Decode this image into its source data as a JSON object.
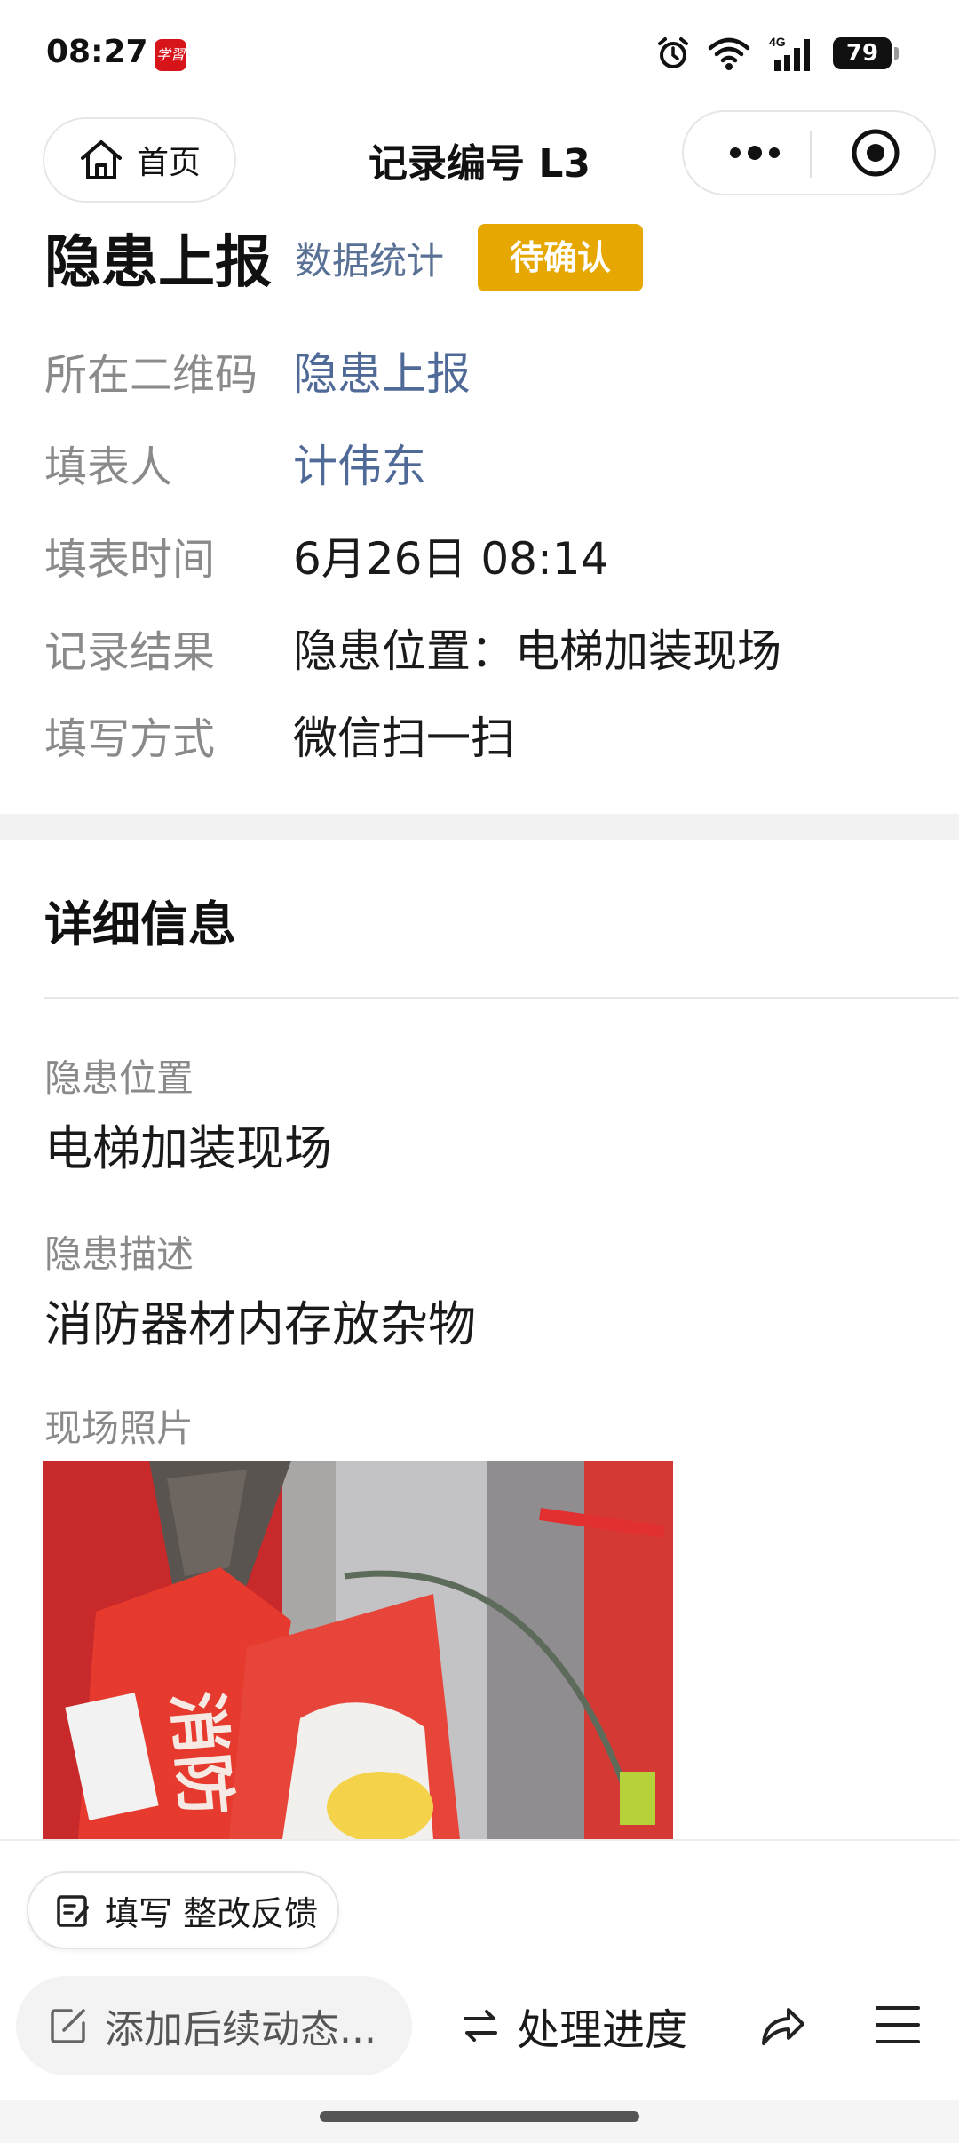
{
  "status_bar": {
    "time": "08:27",
    "app_badge": "学習",
    "network": "4G",
    "battery": "79"
  },
  "nav": {
    "home_label": "首页",
    "title": "记录编号 L3"
  },
  "record": {
    "title": "隐患上报",
    "stats_link": "数据统计",
    "status_badge": "待确认",
    "status_color": "#e6a700"
  },
  "info": [
    {
      "key": "所在二维码",
      "value": "隐患上报"
    },
    {
      "key": "填表人",
      "value": "计伟东"
    },
    {
      "key": "填表时间",
      "value": "6月26日 08:14"
    },
    {
      "key": "记录结果",
      "value": "隐患位置：电梯加装现场"
    },
    {
      "key": "填写方式",
      "value": "微信扫一扫"
    }
  ],
  "details": {
    "title": "详细信息",
    "fields": [
      {
        "label": "隐患位置",
        "value": "电梯加装现场"
      },
      {
        "label": "隐患描述",
        "value": "消防器材内存放杂物"
      },
      {
        "label": "现场照片",
        "value": ""
      }
    ]
  },
  "actions": {
    "feedback_label": "填写 整改反馈",
    "add_followup_label": "添加后续动态...",
    "progress_label": "处理进度"
  },
  "colors": {
    "link": "#4f6a97",
    "label": "#8a8a8a",
    "badge": "#e6a700"
  }
}
